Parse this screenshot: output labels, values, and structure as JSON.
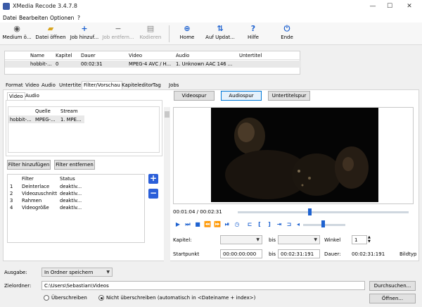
{
  "window": {
    "title": "XMedia Recode 3.4.7.8",
    "minimize": "—",
    "maximize": "☐",
    "close": "✕"
  },
  "menu": [
    "Datei",
    "Bearbeiten",
    "Optionen",
    "?"
  ],
  "toolbar": {
    "medium": "Medium ö...",
    "datei_oeffnen": "Datei öffnen",
    "job_hinzu": "Job hinzuf...",
    "job_entf": "Job entfern...",
    "kodieren": "Kodieren",
    "home": "Home",
    "update": "Auf Updat...",
    "hilfe": "Hilfe",
    "ende": "Ende"
  },
  "jobs": {
    "columns": [
      "Name",
      "Kapitel",
      "Dauer",
      "Video",
      "Audio",
      "Untertitel"
    ],
    "rows": [
      {
        "name": "hobbit-...",
        "kapitel": "0",
        "dauer": "00:02:31",
        "video": "MPEG-4 AVC / H...",
        "audio": "1. Unknown AAC  146 ...",
        "untertitel": ""
      }
    ]
  },
  "tabs": [
    "Format",
    "Video",
    "Audio",
    "Untertitel",
    "Filter/Vorschau",
    "Kapiteleditor",
    "Tag",
    "Jobs"
  ],
  "subtabs": [
    "Video",
    "Audio"
  ],
  "streams": {
    "columns": [
      "Quelle",
      "Stream"
    ],
    "row": {
      "name": "hobbit-...",
      "quelle": "MPEG-...",
      "stream": "1. MPE..."
    }
  },
  "filter_buttons": {
    "add": "Filter hinzufügen",
    "remove": "Filter entfernen"
  },
  "filters": {
    "columns": [
      "Filter",
      "Status"
    ],
    "rows": [
      {
        "nr": "1",
        "name": "Deinterlace",
        "status": "deaktiv..."
      },
      {
        "nr": "2",
        "name": "Videozuschnitt",
        "status": "deaktiv..."
      },
      {
        "nr": "3",
        "name": "Rahmen",
        "status": "deaktiv..."
      },
      {
        "nr": "4",
        "name": "Videogröße",
        "status": "deaktiv..."
      }
    ]
  },
  "side_buttons": {
    "plus": "+",
    "minus": "−"
  },
  "preview": {
    "videospur": "Videospur",
    "audiospur": "Audiospur",
    "untertitelspur": "Untertitelspur",
    "timecode": "00:01:04 / 00:02:31",
    "seek_fraction": 0.42,
    "volume_fraction": 0.46
  },
  "kapitel": {
    "label": "Kapitel:",
    "bis": "bis",
    "winkel_label": "Winkel",
    "winkel_value": "1"
  },
  "start": {
    "label": "Startpunkt",
    "from": "00:00:00:000",
    "bis": "bis",
    "to": "00:02:31:191",
    "dauer_label": "Dauer:",
    "dauer": "00:02:31:191",
    "bildtyp": "Bildtyp"
  },
  "output": {
    "ausgabe_label": "Ausgabe:",
    "ausgabe_value": "In Ordner speichern",
    "ziel_label": "Zielordner:",
    "ziel_value": "C:\\Users\\Sebastian\\Videos",
    "browse": "Durchsuchen...",
    "open": "Öffnen...",
    "radio_overwrite": "Überschreiben",
    "radio_no_overwrite": "Nicht überschreiben (automatisch in <Dateiname + index>)"
  }
}
